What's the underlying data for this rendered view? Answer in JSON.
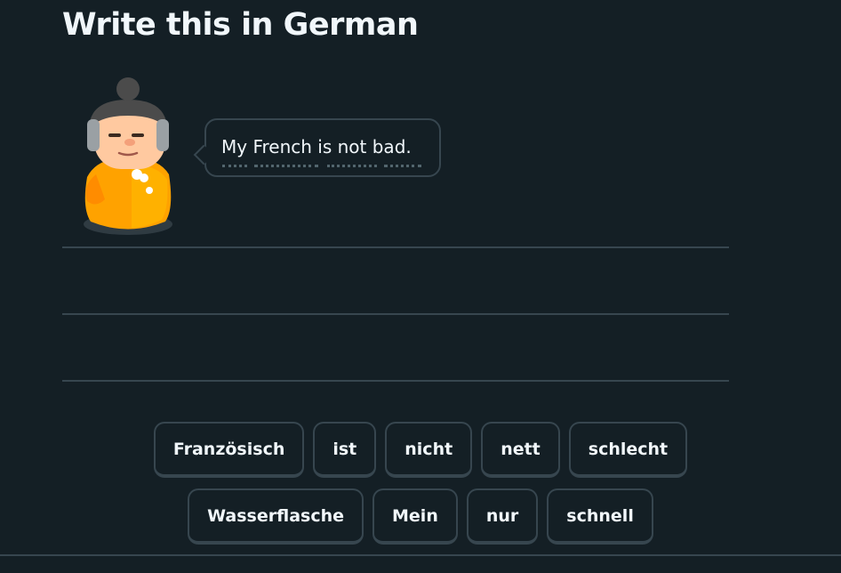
{
  "header": {
    "title": "Write this in German"
  },
  "prompt": {
    "character": "character-illustration",
    "sentence": "My French is not bad."
  },
  "word_bank": {
    "rows": [
      [
        "Französisch",
        "ist",
        "nicht",
        "nett",
        "schlecht"
      ],
      [
        "Wasserflasche",
        "Mein",
        "nur",
        "schnell"
      ]
    ]
  },
  "colors": {
    "background": "#141f25",
    "border": "#37464f",
    "text": "#f1f7fb",
    "character_orange": "#ffa200"
  }
}
